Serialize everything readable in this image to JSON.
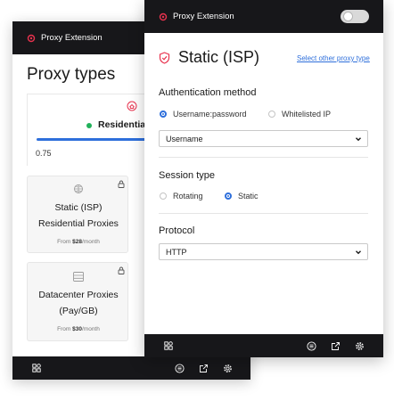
{
  "back_window": {
    "header_title": "Proxy Extension",
    "heading": "Proxy types",
    "residential": {
      "label": "Residential",
      "value": "0.75",
      "status_color": "#21b15a"
    },
    "cards": [
      {
        "title_line1": "Static (ISP)",
        "title_line2": "Residential Proxies",
        "price_prefix": "From ",
        "price": "$28",
        "price_suffix": "/month",
        "icon": "globe-network-icon"
      },
      {
        "title_line1": "Datacenter Proxies",
        "title_line2": "(Pay/GB)",
        "price_prefix": "From ",
        "price": "$30",
        "price_suffix": "/month",
        "icon": "server-icon"
      }
    ]
  },
  "front_window": {
    "header_title": "Proxy Extension",
    "heading": "Static (ISP)",
    "change_link": "Select other proxy type",
    "auth": {
      "title": "Authentication method",
      "options": [
        "Username:password",
        "Whitelisted IP"
      ],
      "selected": "Username:password",
      "select_value": "Username"
    },
    "session": {
      "title": "Session type",
      "options": [
        "Rotating",
        "Static"
      ],
      "selected": "Static"
    },
    "protocol": {
      "title": "Protocol",
      "select_value": "HTTP"
    }
  },
  "colors": {
    "accent": "#2e6fdb",
    "brand": "#e8324e",
    "bar_dark": "#17171a"
  }
}
